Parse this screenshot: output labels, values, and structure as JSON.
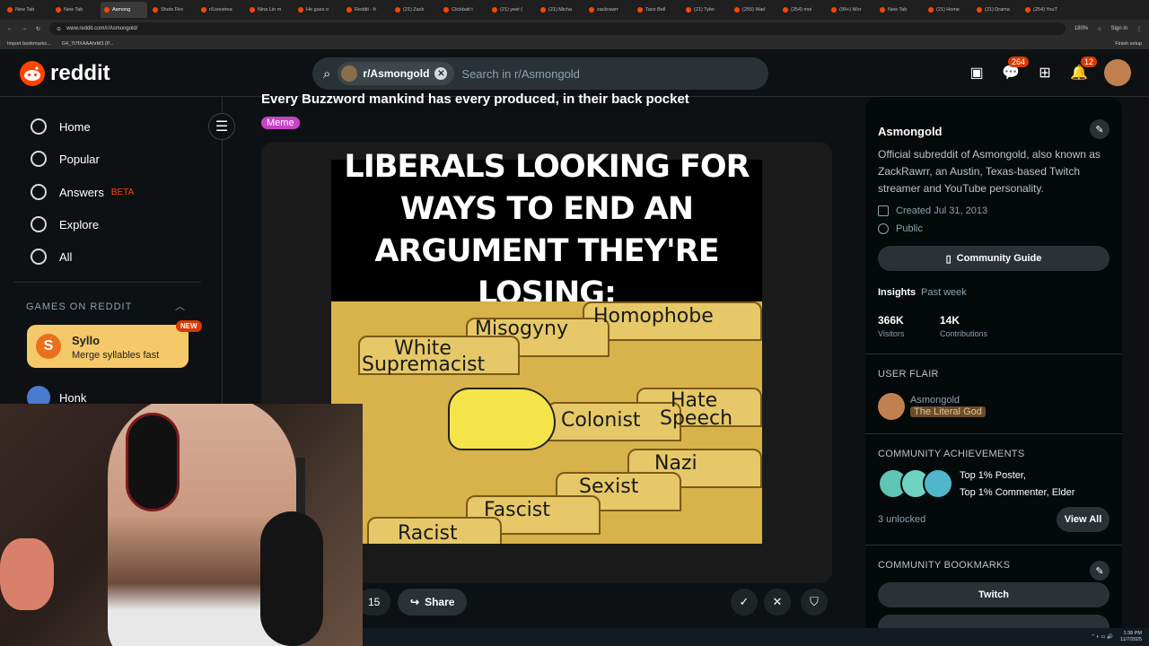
{
  "browser": {
    "tabs": [
      "New Tab",
      "New Tab",
      "Asmong",
      "Shots Fire",
      "r/Livestrea",
      "Nina Lin m",
      "He goes o",
      "Reddit - fr",
      "(21) Zack",
      "Clickbait t",
      "(21) yeet (",
      "(21) Micha",
      "zackrawrr",
      "Taco Bell",
      "(21) Tyler",
      "(255) Warl",
      "(254) moi",
      "(99+) Wor",
      "New Tab",
      "(21) Home",
      "(21) Drama",
      "(254) YouT"
    ],
    "active_tab_index": 2,
    "url": "www.reddit.com/r/Asmongold/",
    "zoom": "180%",
    "sign_in": "Sign in",
    "bookmarks": [
      "Import bookmarks...",
      "G4_7t7fXAAAhrM3 (P..."
    ],
    "finish_setup": "Finish setup"
  },
  "header": {
    "logo_text": "reddit",
    "community_chip": "r/Asmongold",
    "search_placeholder": "Search in r/Asmongold",
    "chat_badge": "264",
    "notification_badge": "12"
  },
  "nav": {
    "items": [
      {
        "label": "Home",
        "icon": "home-icon"
      },
      {
        "label": "Popular",
        "icon": "popular-icon"
      },
      {
        "label": "Answers",
        "icon": "answers-icon",
        "tag": "BETA"
      },
      {
        "label": "Explore",
        "icon": "explore-icon"
      },
      {
        "label": "All",
        "icon": "all-icon"
      }
    ],
    "games_heading": "GAMES ON REDDIT",
    "syllo": {
      "title": "Syllo",
      "subtitle": "Merge syllables fast",
      "badge": "NEW",
      "icon_letter": "S"
    },
    "honk": "Honk"
  },
  "post": {
    "title": "Every Buzzword mankind has every produced, in their back pocket",
    "flair": "Meme",
    "meme_caption_lines": [
      "LIBERALS LOOKING FOR",
      "WAYS TO END AN",
      "ARGUMENT THEY'RE LOSING:"
    ],
    "folder_labels": [
      "Homophobe",
      "Misogyny",
      "White",
      "Supremacist",
      "Hate",
      "Speech",
      "Colonist",
      "Nazi",
      "Sexist",
      "Fascist",
      "Racist"
    ],
    "comment_count": "15",
    "share_label": "Share"
  },
  "sidebar": {
    "name": "Asmongold",
    "description": "Official subreddit of Asmongold, also known as ZackRawrr, an Austin, Texas-based Twitch streamer and YouTube personality.",
    "created": "Created Jul 31, 2013",
    "visibility": "Public",
    "guide_button": "Community Guide",
    "insights_label": "Insights",
    "insights_range": "Past week",
    "visitors_value": "366K",
    "visitors_label": "Visitors",
    "contributions_value": "14K",
    "contributions_label": "Contributions",
    "user_flair_heading": "USER FLAIR",
    "flair_user": "Asmongold",
    "flair_tag": "The Literal God",
    "achievements_heading": "COMMUNITY ACHIEVEMENTS",
    "achievements_line1": "Top 1% Poster,",
    "achievements_line2": "Top 1% Commenter, Elder",
    "unlocked": "3 unlocked",
    "view_all": "View All",
    "bookmarks_heading": "COMMUNITY BOOKMARKS",
    "bookmark_twitch": "Twitch"
  },
  "taskbar": {
    "time": "1:38 PM",
    "date": "11/7/2025"
  },
  "colors": {
    "reddit_orange": "#ff4500",
    "flair_purple": "#c643c6",
    "syllo_yellow": "#f5c96a"
  }
}
